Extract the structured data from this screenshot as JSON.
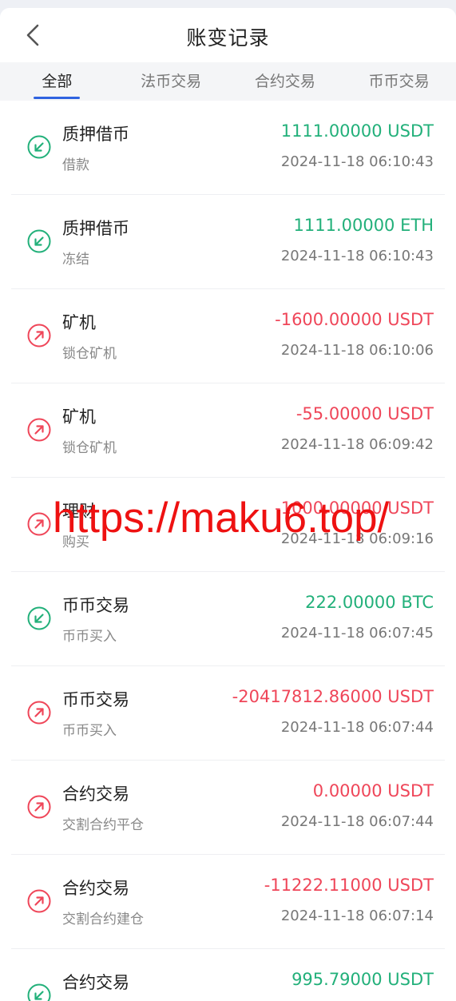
{
  "header": {
    "title": "账变记录"
  },
  "tabs": [
    {
      "label": "全部",
      "active": true
    },
    {
      "label": "法币交易",
      "active": false
    },
    {
      "label": "合约交易",
      "active": false
    },
    {
      "label": "币币交易",
      "active": false
    }
  ],
  "colors": {
    "positive": "#22b07a",
    "negative": "#ef4659",
    "accent": "#2f63e0"
  },
  "records": [
    {
      "type": "质押借币",
      "subtype": "借款",
      "amount": "1111.00000 USDT",
      "time": "2024-11-18 06:10:43",
      "direction": "in",
      "icon": "arrow-down-left-icon"
    },
    {
      "type": "质押借币",
      "subtype": "冻结",
      "amount": "1111.00000 ETH",
      "time": "2024-11-18 06:10:43",
      "direction": "in",
      "icon": "arrow-down-left-icon"
    },
    {
      "type": "矿机",
      "subtype": "锁仓矿机",
      "amount": "-1600.00000 USDT",
      "time": "2024-11-18 06:10:06",
      "direction": "out",
      "icon": "arrow-up-right-icon"
    },
    {
      "type": "矿机",
      "subtype": "锁仓矿机",
      "amount": "-55.00000 USDT",
      "time": "2024-11-18 06:09:42",
      "direction": "out",
      "icon": "arrow-up-right-icon"
    },
    {
      "type": "理财",
      "subtype": "购买",
      "amount": "-1000.00000 USDT",
      "time": "2024-11-18 06:09:16",
      "direction": "out",
      "icon": "arrow-up-right-icon"
    },
    {
      "type": "币币交易",
      "subtype": "币币买入",
      "amount": "222.00000 BTC",
      "time": "2024-11-18 06:07:45",
      "direction": "in",
      "icon": "arrow-down-left-icon"
    },
    {
      "type": "币币交易",
      "subtype": "币币买入",
      "amount": "-20417812.86000 USDT",
      "time": "2024-11-18 06:07:44",
      "direction": "out",
      "icon": "arrow-up-right-icon"
    },
    {
      "type": "合约交易",
      "subtype": "交割合约平仓",
      "amount": "0.00000 USDT",
      "time": "2024-11-18 06:07:44",
      "direction": "out",
      "icon": "arrow-up-right-icon"
    },
    {
      "type": "合约交易",
      "subtype": "交割合约建仓",
      "amount": "-11222.11000 USDT",
      "time": "2024-11-18 06:07:14",
      "direction": "out",
      "icon": "arrow-up-right-icon"
    },
    {
      "type": "合约交易",
      "subtype": "",
      "amount": "995.79000 USDT",
      "time": "",
      "direction": "in",
      "icon": "arrow-down-left-icon"
    }
  ],
  "watermark": "https://maku6.top/"
}
